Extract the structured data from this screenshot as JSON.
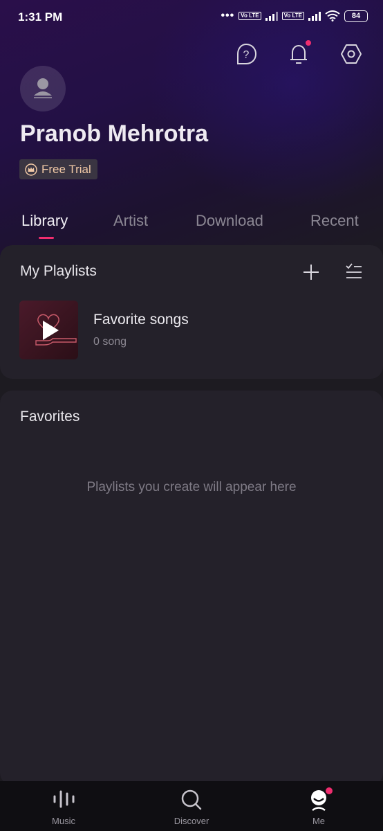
{
  "status_bar": {
    "time": "1:31 PM",
    "sim1_label": "Vo LTE",
    "sim2_label": "Vo LTE",
    "battery": "84"
  },
  "header": {
    "icons": [
      "help-icon",
      "bell-icon",
      "settings-icon"
    ],
    "has_notification": true
  },
  "profile": {
    "name": "Pranob Mehrotra",
    "badge": "Free Trial"
  },
  "tabs": [
    {
      "label": "Library",
      "active": true
    },
    {
      "label": "Artist",
      "active": false
    },
    {
      "label": "Download",
      "active": false
    },
    {
      "label": "Recent",
      "active": false
    }
  ],
  "playlists": {
    "title": "My Playlists",
    "items": [
      {
        "name": "Favorite songs",
        "count": "0 song"
      }
    ]
  },
  "favorites": {
    "title": "Favorites",
    "empty_message": "Playlists you create will appear here"
  },
  "bottom_nav": [
    {
      "label": "Music",
      "icon": "music-bars-icon",
      "active": false
    },
    {
      "label": "Discover",
      "icon": "search-icon",
      "active": false
    },
    {
      "label": "Me",
      "icon": "me-face-icon",
      "active": true
    }
  ],
  "colors": {
    "accent": "#ef2d6e",
    "background": "#1d1b21",
    "card": "#24212a",
    "badge_text": "#f1c9a6"
  }
}
